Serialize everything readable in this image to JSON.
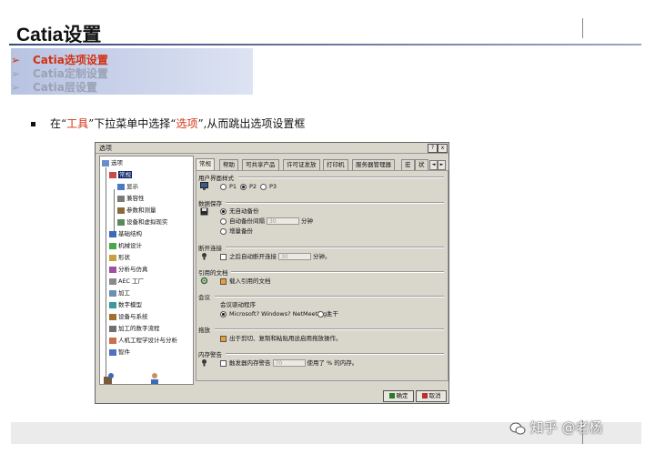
{
  "slide": {
    "title": "Catia设置",
    "outline": [
      {
        "label": "Catia选项设置",
        "state": "active"
      },
      {
        "label": "Catia定制设置",
        "state": "inactive"
      },
      {
        "label": "Catia层设置",
        "state": "inactive"
      }
    ],
    "bullet": {
      "prefix": "在“",
      "menu": "工具",
      "mid": "”下拉菜单中选择“",
      "item": "选项",
      "suffix": "”,从而跳出选项设置框"
    },
    "watermark": "知乎 @老杨"
  },
  "dialog": {
    "title": "选项",
    "title_buttons": [
      "?",
      "x"
    ],
    "tree": [
      {
        "label": "选项",
        "level": 0
      },
      {
        "label": "常规",
        "level": 1,
        "selected": true
      },
      {
        "label": "显示",
        "level": 2
      },
      {
        "label": "兼容性",
        "level": 2
      },
      {
        "label": "参数和测量",
        "level": 2
      },
      {
        "label": "设备和虚拟现实",
        "level": 2
      },
      {
        "label": "基础结构",
        "level": 1
      },
      {
        "label": "机械设计",
        "level": 1
      },
      {
        "label": "形状",
        "level": 1
      },
      {
        "label": "分析与仿真",
        "level": 1
      },
      {
        "label": "AEC 工厂",
        "level": 1
      },
      {
        "label": "加工",
        "level": 1
      },
      {
        "label": "数字模型",
        "level": 1
      },
      {
        "label": "设备与系统",
        "level": 1
      },
      {
        "label": "加工的数字流程",
        "level": 1
      },
      {
        "label": "人机工程学设计与分析",
        "level": 1
      },
      {
        "label": "智件",
        "level": 1
      }
    ],
    "tabs": [
      "常规",
      "帮助",
      "可共享产品",
      "许可证发放",
      "打印机",
      "服务器管理器",
      "宏",
      "状"
    ],
    "tab_arrows": [
      "◄",
      "►"
    ],
    "sections": {
      "ui_style": {
        "label": "用户界面样式",
        "options": [
          "P1",
          "P2",
          "P3"
        ],
        "selected": "P2"
      },
      "data_save": {
        "label": "数据保存",
        "opt_none": "无自动备份",
        "opt_auto": "自动备份间隔",
        "auto_value": "30",
        "auto_unit": "分钟",
        "opt_incr": "增量备份"
      },
      "disconnect": {
        "label": "断开连接",
        "check_label": "之后自动断开连接",
        "value": "30",
        "unit": "分钟。"
      },
      "referenced_docs": {
        "label": "引用的文档",
        "check_label": "载入引用的文档"
      },
      "meeting": {
        "label": "会议",
        "driver_label": "会议驱动程序",
        "opt_ms": "Microsoft? Windows? NetMeeting?",
        "opt_host": "主干"
      },
      "drag": {
        "label": "拖放",
        "check_label": "出于剪切、复制和粘贴用途启用拖放操作。"
      },
      "memory": {
        "label": "内存警告",
        "check_label": "触发器内存警告",
        "value": "70",
        "unit": "使用了 % 的内存。"
      }
    },
    "ok_label": "确定",
    "cancel_label": "取消"
  },
  "colors": {
    "accent_red": "#d43010",
    "selection_blue": "#0a246a",
    "dialog_bg": "#d9d6cc"
  }
}
